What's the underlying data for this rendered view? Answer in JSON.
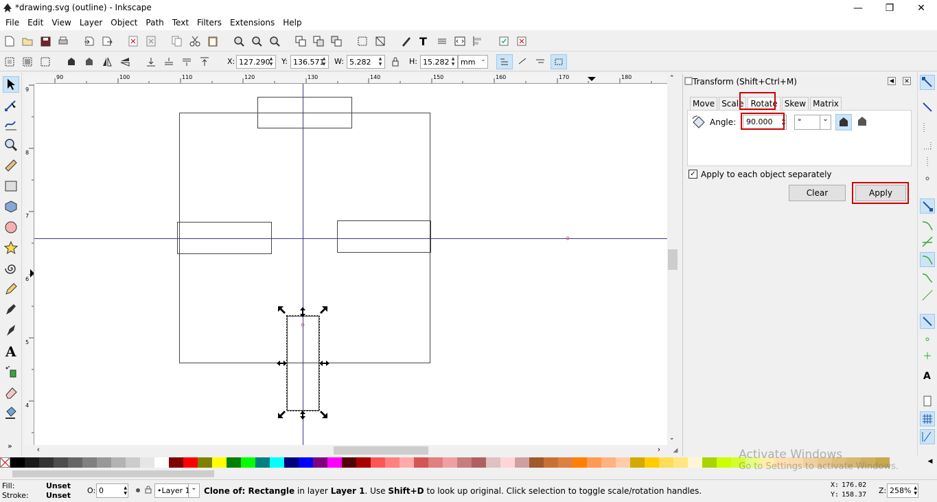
{
  "window": {
    "title": "*drawing.svg (outline) - Inkscape",
    "minimize": "—",
    "maximize": "❐",
    "close": "✕"
  },
  "menu": [
    "File",
    "Edit",
    "View",
    "Layer",
    "Object",
    "Path",
    "Text",
    "Filters",
    "Extensions",
    "Help"
  ],
  "controls": {
    "x_label": "X:",
    "x_value": "127.290",
    "y_label": "Y:",
    "y_value": "136.571",
    "w_label": "W:",
    "w_value": "5.282",
    "h_label": "H:",
    "h_value": "15.282",
    "unit": "mm"
  },
  "ruler_top": [
    "90",
    "100",
    "110",
    "120",
    "130",
    "140",
    "150",
    "160",
    "170",
    "180"
  ],
  "ruler_left": [
    "9",
    "8",
    "7",
    "6",
    "5",
    "4"
  ],
  "transform_dialog": {
    "title": "Transform (Shift+Ctrl+M)",
    "tabs": [
      "Move",
      "Scale",
      "Rotate",
      "Skew",
      "Matrix"
    ],
    "active_tab": "Rotate",
    "angle_label": "Angle:",
    "angle_value": "90.000",
    "angle_unit": "°",
    "apply_each_label": "Apply to each object separately",
    "apply_each_checked": true,
    "clear_label": "Clear",
    "apply_label": "Apply"
  },
  "watermark": {
    "line1": "Activate Windows",
    "line2": "Go to Settings to activate Windows."
  },
  "palette_colors": [
    "#000000",
    "#1a1a1a",
    "#333333",
    "#4d4d4d",
    "#666666",
    "#808080",
    "#999999",
    "#b3b3b3",
    "#cccccc",
    "#e6e6e6",
    "#ffffff",
    "#800000",
    "#ff0000",
    "#808000",
    "#ffff00",
    "#008000",
    "#00ff00",
    "#008080",
    "#00ffff",
    "#000080",
    "#0000ff",
    "#800080",
    "#ff00ff",
    "#550000",
    "#aa0000",
    "#ff5555",
    "#ff8080",
    "#ffaaaa",
    "#d45555",
    "#e08080",
    "#f0a0a0",
    "#c87d7d",
    "#b06060",
    "#e0c0c0",
    "#ffd5d5",
    "#d0a0a0",
    "#a05a2c",
    "#c87137",
    "#e08040",
    "#ff8000",
    "#ff9955",
    "#ffb380",
    "#ffccaa",
    "#d4aa00",
    "#ffcc00",
    "#ffdd55",
    "#ffe680",
    "#fff6d5",
    "#aad400",
    "#ccff00",
    "#d4ff2a",
    "#e5ff80",
    "#ffeeaa",
    "#ffe0b0",
    "#f8dcb0",
    "#f0d0a0",
    "#e8c890",
    "#e0c080",
    "#d8b870",
    "#d0b060",
    "#c8a850"
  ],
  "status": {
    "fill_label": "Fill:",
    "fill_value": "Unset",
    "stroke_label": "Stroke:",
    "stroke_value": "Unset",
    "opacity_label": "O:",
    "opacity_value": "0",
    "layer_value": "•Layer 1",
    "message_b1": "Clone of: Rectangle",
    "message_1": " in layer ",
    "message_b2": "Layer 1",
    "message_2": ". Use ",
    "message_b3": "Shift+D",
    "message_3": " to look up original. Click selection to toggle scale/rotation handles.",
    "cursor_x_label": "X:",
    "cursor_x": "176.02",
    "cursor_y_label": "Y:",
    "cursor_y": "158.37",
    "zoom_label": "Z:",
    "zoom_value": "258%"
  }
}
